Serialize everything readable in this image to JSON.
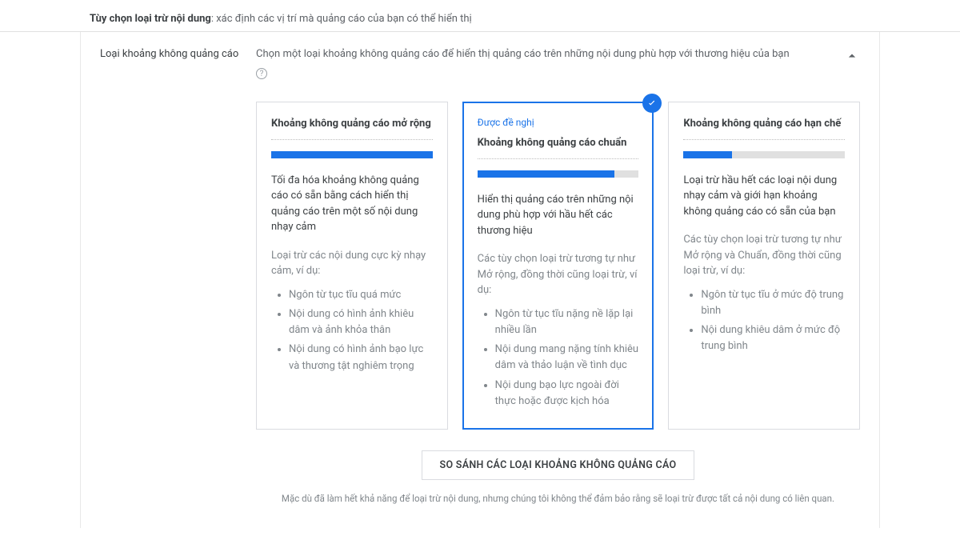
{
  "header": {
    "title_bold": "Tùy chọn loại trừ nội dung",
    "title_rest": ": xác định các vị trí mà quảng cáo của bạn có thể hiển thị"
  },
  "section": {
    "label": "Loại khoảng không quảng cáo",
    "description": "Chọn một loại khoảng không quảng cáo để hiển thị quảng cáo trên những nội dung phù hợp với thương hiệu của bạn",
    "help_glyph": "?"
  },
  "cards": [
    {
      "selected": false,
      "recommended": "",
      "title": "Khoảng không quảng cáo mở rộng",
      "meter_pct": 100,
      "desc": "Tối đa hóa khoảng không quảng cáo có sẵn bằng cách hiển thị quảng cáo trên một số nội dung nhạy cảm",
      "sub": "Loại trừ các nội dung cực kỳ nhạy cảm, ví dụ:",
      "bullets": [
        "Ngôn từ tục tĩu quá mức",
        "Nội dung có hình ảnh khiêu dâm và ảnh khỏa thân",
        "Nội dung có hình ảnh bạo lực và thương tật nghiêm trọng"
      ]
    },
    {
      "selected": true,
      "recommended": "Được đề nghị",
      "title": "Khoảng không quảng cáo chuẩn",
      "meter_pct": 85,
      "desc": "Hiển thị quảng cáo trên những nội dung phù hợp với hầu hết các thương hiệu",
      "sub": "Các tùy chọn loại trừ tương tự như Mở rộng, đồng thời cũng loại trừ, ví dụ:",
      "bullets": [
        "Ngôn từ tục tĩu nặng nề lặp lại nhiều lần",
        "Nội dung mang nặng tính khiêu dâm và thảo luận về tình dục",
        "Nội dung bạo lực ngoài đời thực hoặc được kịch hóa"
      ]
    },
    {
      "selected": false,
      "recommended": "",
      "title": "Khoảng không quảng cáo hạn chế",
      "meter_pct": 30,
      "desc": "Loại trừ hầu hết các loại nội dung nhạy cảm và giới hạn khoảng không quảng cáo có sẵn của bạn",
      "sub": "Các tùy chọn loại trừ tương tự như Mở rộng và Chuẩn, đồng thời cũng loại trừ, ví dụ:",
      "bullets": [
        "Ngôn từ tục tĩu ở mức độ trung bình",
        "Nội dung khiêu dâm ở mức độ trung bình"
      ]
    }
  ],
  "compare_button": "SO SÁNH CÁC LOẠI KHOẢNG KHÔNG QUẢNG CÁO",
  "disclaimer": "Mặc dù đã làm hết khả năng để loại trừ nội dung, nhưng chúng tôi không thể đảm bảo rằng sẽ loại trừ được tất cả nội dung có liên quan."
}
